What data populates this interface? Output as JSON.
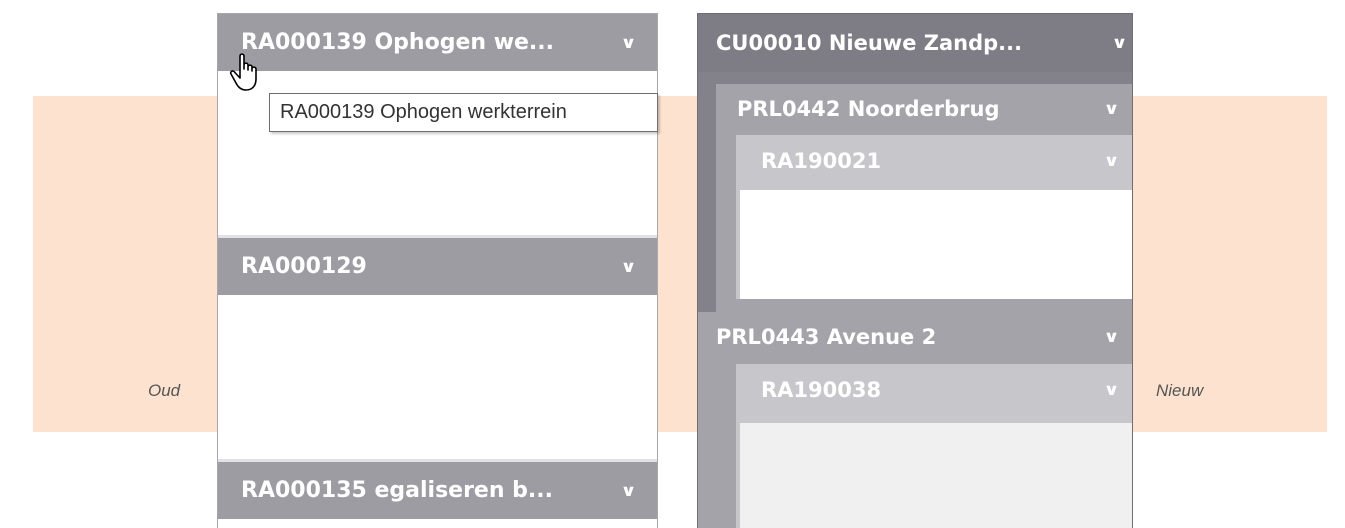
{
  "labels": {
    "old": "Oud",
    "new": "Nieuw"
  },
  "old_panel": {
    "sections": [
      {
        "title": "RA000139 Ophogen we...",
        "tooltip": "RA000139 Ophogen werkterrein"
      },
      {
        "title": "RA000129"
      },
      {
        "title": "RA000135 egaliseren b..."
      }
    ]
  },
  "new_panel": {
    "title": "CU00010 Nieuwe Zandp...",
    "groups": [
      {
        "title": "PRL0442 Noorderbrug",
        "items": [
          {
            "title": "RA190021"
          }
        ]
      },
      {
        "title": "PRL0443 Avenue 2",
        "items": [
          {
            "title": "RA190038"
          }
        ]
      }
    ]
  },
  "icons": {
    "expand": "chevron-down-icon",
    "cursor": "hand-pointer-icon"
  },
  "colors": {
    "background_band": "#fde2d0",
    "header_dark": "#7e7d85",
    "header_mid": "#9d9ca3",
    "header_light": "#c7c6cb"
  }
}
